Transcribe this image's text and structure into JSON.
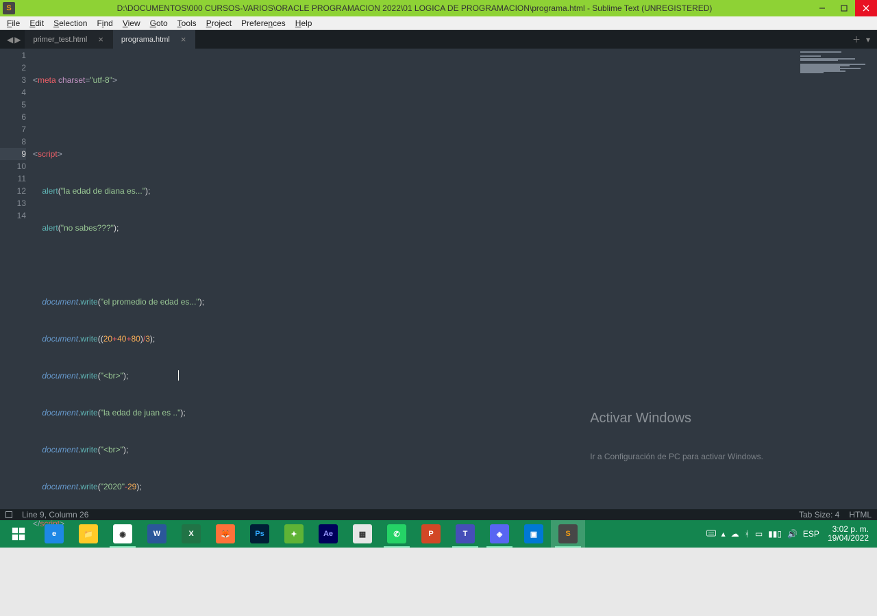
{
  "window": {
    "title": "D:\\DOCUMENTOS\\000 CURSOS-VARIOS\\ORACLE PROGRAMACION 2022\\01 LOGICA DE PROGRAMACION\\programa.html - Sublime Text (UNREGISTERED)"
  },
  "menu": {
    "file": "File",
    "edit": "Edit",
    "selection": "Selection",
    "find": "Find",
    "view": "View",
    "goto": "Goto",
    "tools": "Tools",
    "project": "Project",
    "preferences": "Preferences",
    "help": "Help"
  },
  "tabs": {
    "t0": "primer_test.html",
    "t1": "programa.html"
  },
  "code": {
    "l1a": "<",
    "l1b": "meta",
    "l1c": " charset",
    "l1d": "=",
    "l1e": "\"utf-8\"",
    "l1f": ">",
    "l3a": "<",
    "l3b": "script",
    "l3c": ">",
    "l4a": "    alert",
    "l4b": "(",
    "l4c": "\"la edad de diana es...\"",
    "l4d": ")",
    "l4e": ";",
    "l5a": "    alert",
    "l5b": "(",
    "l5c": "\"no sabes???\"",
    "l5d": ")",
    "l5e": ";",
    "l7a": "    ",
    "l7b": "document",
    "l7c": ".",
    "l7d": "write",
    "l7e": "(",
    "l7f": "\"el promedio de edad es...\"",
    "l7g": ")",
    "l7h": ";",
    "l8a": "    ",
    "l8b": "document",
    "l8c": ".",
    "l8d": "write",
    "l8e": "((",
    "l8f": "20",
    "l8g": "+",
    "l8h": "40",
    "l8i": "+",
    "l8j": "80",
    "l8k": ")",
    "l8l": "/",
    "l8m": "3",
    "l8n": ")",
    "l8o": ";",
    "l9a": "    ",
    "l9b": "document",
    "l9c": ".",
    "l9d": "write",
    "l9e": "(",
    "l9f": "\"<br>\"",
    "l9g": ")",
    "l9h": ";",
    "l10a": "    ",
    "l10b": "document",
    "l10c": ".",
    "l10d": "write",
    "l10e": "(",
    "l10f": "\"la edad de juan es ..\"",
    "l10g": ")",
    "l10h": ";",
    "l11a": "    ",
    "l11b": "document",
    "l11c": ".",
    "l11d": "write",
    "l11e": "(",
    "l11f": "\"<br>\"",
    "l11g": ")",
    "l11h": ";",
    "l12a": "    ",
    "l12b": "document",
    "l12c": ".",
    "l12d": "write",
    "l12e": "(",
    "l12f": "\"2020\"",
    "l12g": "-",
    "l12h": "29",
    "l12i": ")",
    "l12j": ";",
    "l13a": "</",
    "l13b": "script",
    "l13c": ">"
  },
  "lines": {
    "n1": "1",
    "n2": "2",
    "n3": "3",
    "n4": "4",
    "n5": "5",
    "n6": "6",
    "n7": "7",
    "n8": "8",
    "n9": "9",
    "n10": "10",
    "n11": "11",
    "n12": "12",
    "n13": "13",
    "n14": "14"
  },
  "watermark": {
    "l1": "Activar Windows",
    "l2": "Ir a Configuración de PC para activar Windows."
  },
  "status": {
    "pos": "Line 9, Column 26",
    "tab": "Tab Size: 4",
    "lang": "HTML"
  },
  "tray": {
    "lang": "ESP",
    "time": "3:02 p. m.",
    "date": "19/04/2022"
  }
}
